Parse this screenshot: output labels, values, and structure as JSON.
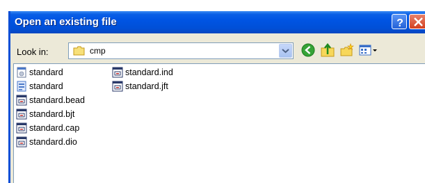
{
  "window": {
    "title": "Open an existing file"
  },
  "toolbar": {
    "look_in_label": "Look in:",
    "current_folder": "cmp",
    "icons": [
      "back-icon",
      "up-folder-icon",
      "new-folder-icon",
      "views-menu-icon"
    ]
  },
  "files": {
    "column1": [
      {
        "name": "standard",
        "icon": "drawing-document-icon"
      },
      {
        "name": "standard",
        "icon": "reference-document-icon"
      },
      {
        "name": "standard.bead",
        "icon": "component-file-icon"
      },
      {
        "name": "standard.bjt",
        "icon": "component-file-icon"
      },
      {
        "name": "standard.cap",
        "icon": "component-file-icon"
      },
      {
        "name": "standard.dio",
        "icon": "component-file-icon"
      }
    ],
    "column2": [
      {
        "name": "standard.ind",
        "icon": "component-file-icon"
      },
      {
        "name": "standard.jft",
        "icon": "component-file-icon"
      }
    ]
  },
  "colors": {
    "title_bar": "#0054e3",
    "dialog_bg": "#ece9d8",
    "close_button": "#d3401f"
  }
}
